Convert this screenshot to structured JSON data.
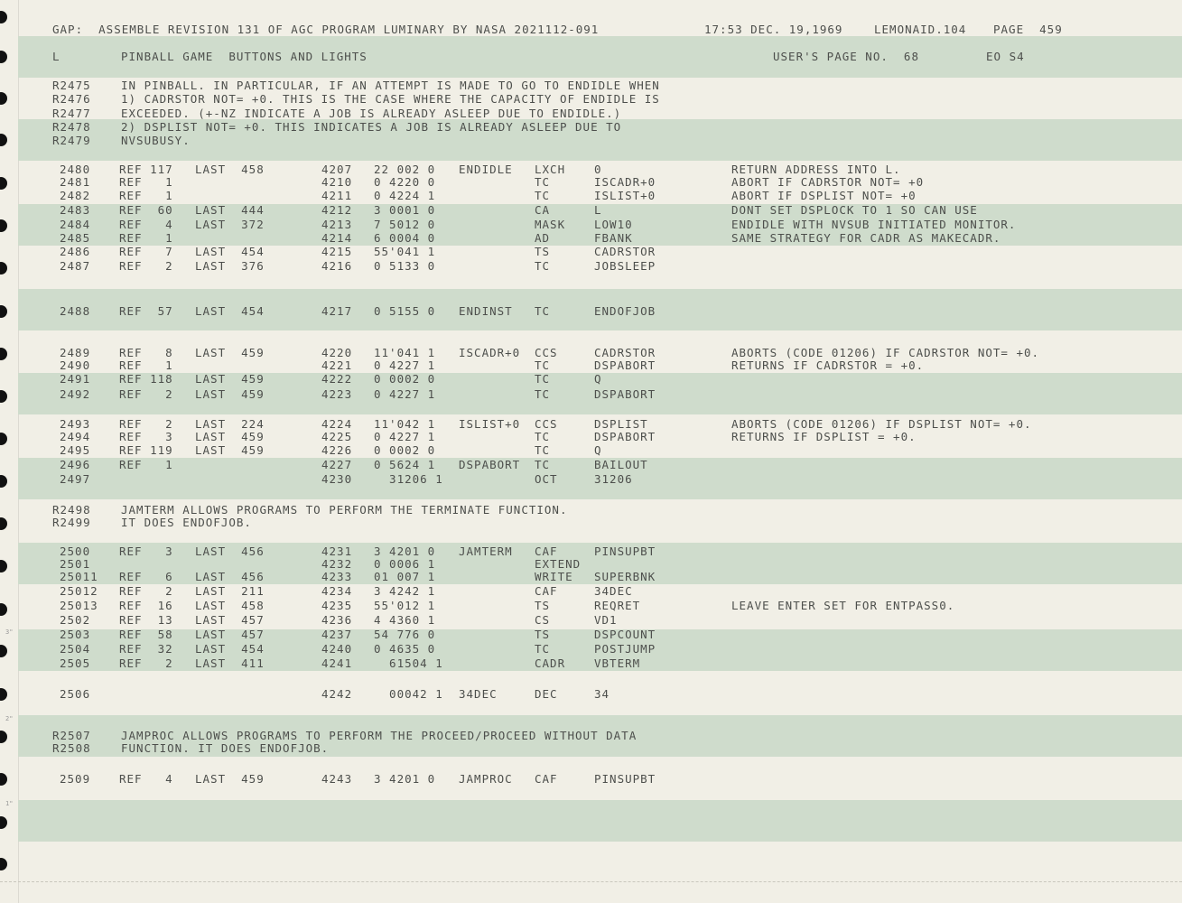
{
  "header": {
    "program_line": "GAP:  ASSEMBLE REVISION 131 OF AGC PROGRAM LUMINARY BY NASA 2021112-091",
    "timestamp": "17:53 DEC. 19,1969",
    "assembler": "LEMONAID.104",
    "page_label": "PAGE  459",
    "log_code": "L",
    "section_title": "PINBALL GAME  BUTTONS AND LIGHTS",
    "users_page": "USER'S PAGE NO.  68",
    "eo_code": "EO S4"
  },
  "comment1": [
    [
      "R2475",
      "IN PINBALL. IN PARTICULAR, IF AN ATTEMPT IS MADE TO GO TO ENDIDLE WHEN"
    ],
    [
      "R2476",
      "1) CADRSTOR NOT= +0. THIS IS THE CASE WHERE THE CAPACITY OF ENDIDLE IS"
    ],
    [
      "R2477",
      "EXCEEDED. (+-NZ INDICATE A JOB IS ALREADY ASLEEP DUE TO ENDIDLE.)"
    ],
    [
      "R2478",
      "2) DSPLIST NOT= +0. THIS INDICATES A JOB IS ALREADY ASLEEP DUE TO"
    ],
    [
      "R2479",
      "NVSUBUSY."
    ]
  ],
  "block1": [
    [
      "2480",
      "REF 117",
      "LAST  458",
      "4207",
      "22 002 0",
      "ENDIDLE",
      "LXCH",
      "0",
      "RETURN ADDRESS INTO L."
    ],
    [
      "2481",
      "REF   1",
      "",
      "4210",
      "0 4220 0",
      "",
      "TC",
      "ISCADR+0",
      "ABORT IF CADRSTOR NOT= +0"
    ],
    [
      "2482",
      "REF   1",
      "",
      "4211",
      "0 4224 1",
      "",
      "TC",
      "ISLIST+0",
      "ABORT IF DSPLIST NOT= +0"
    ],
    [
      "2483",
      "REF  60",
      "LAST  444",
      "4212",
      "3 0001 0",
      "",
      "CA",
      "L",
      "DONT SET DSPLOCK TO 1 SO CAN USE"
    ],
    [
      "2484",
      "REF   4",
      "LAST  372",
      "4213",
      "7 5012 0",
      "",
      "MASK",
      "LOW10",
      "ENDIDLE WITH NVSUB INITIATED MONITOR."
    ],
    [
      "2485",
      "REF   1",
      "",
      "4214",
      "6 0004 0",
      "",
      "AD",
      "FBANK",
      "SAME STRATEGY FOR CADR AS MAKECADR."
    ],
    [
      "2486",
      "REF   7",
      "LAST  454",
      "4215",
      "55'041 1",
      "",
      "TS",
      "CADRSTOR",
      ""
    ],
    [
      "2487",
      "REF   2",
      "LAST  376",
      "4216",
      "0 5133 0",
      "",
      "TC",
      "JOBSLEEP",
      ""
    ]
  ],
  "line2488": [
    "2488",
    "REF  57",
    "LAST  454",
    "4217",
    "0 5155 0",
    "ENDINST",
    "TC",
    "ENDOFJOB",
    ""
  ],
  "block2": [
    [
      "2489",
      "REF   8",
      "LAST  459",
      "4220",
      "11'041 1",
      "ISCADR+0",
      "CCS",
      "CADRSTOR",
      "ABORTS (CODE 01206) IF CADRSTOR NOT= +0."
    ],
    [
      "2490",
      "REF   1",
      "",
      "4221",
      "0 4227 1",
      "",
      "TC",
      "DSPABORT",
      "RETURNS IF CADRSTOR = +0."
    ],
    [
      "2491",
      "REF 118",
      "LAST  459",
      "4222",
      "0 0002 0",
      "",
      "TC",
      "Q",
      ""
    ],
    [
      "2492",
      "REF   2",
      "LAST  459",
      "4223",
      "0 4227 1",
      "",
      "TC",
      "DSPABORT",
      ""
    ]
  ],
  "block3": [
    [
      "2493",
      "REF   2",
      "LAST  224",
      "4224",
      "11'042 1",
      "ISLIST+0",
      "CCS",
      "DSPLIST",
      "ABORTS (CODE 01206) IF DSPLIST NOT= +0."
    ],
    [
      "2494",
      "REF   3",
      "LAST  459",
      "4225",
      "0 4227 1",
      "",
      "TC",
      "DSPABORT",
      "RETURNS IF DSPLIST = +0."
    ],
    [
      "2495",
      "REF 119",
      "LAST  459",
      "4226",
      "0 0002 0",
      "",
      "TC",
      "Q",
      ""
    ],
    [
      "2496",
      "REF   1",
      "",
      "4227",
      "0 5624 1",
      "DSPABORT",
      "TC",
      "BAILOUT",
      ""
    ],
    [
      "2497",
      "",
      "",
      "4230",
      "  31206 1",
      "",
      "OCT",
      "31206",
      ""
    ]
  ],
  "comment2": [
    [
      "R2498",
      "JAMTERM ALLOWS PROGRAMS TO PERFORM THE TERMINATE FUNCTION."
    ],
    [
      "R2499",
      "IT DOES ENDOFJOB."
    ]
  ],
  "block4": [
    [
      "2500",
      "REF   3",
      "LAST  456",
      "4231",
      "3 4201 0",
      "JAMTERM",
      "CAF",
      "PINSUPBT",
      ""
    ],
    [
      "2501",
      "",
      "",
      "4232",
      "0 0006 1",
      "",
      "EXTEND",
      "",
      ""
    ],
    [
      "25011",
      "REF   6",
      "LAST  456",
      "4233",
      "01 007 1",
      "",
      "WRITE",
      "SUPERBNK",
      ""
    ],
    [
      "25012",
      "REF   2",
      "LAST  211",
      "4234",
      "3 4242 1",
      "",
      "CAF",
      "34DEC",
      ""
    ],
    [
      "25013",
      "REF  16",
      "LAST  458",
      "4235",
      "55'012 1",
      "",
      "TS",
      "REQRET",
      "LEAVE ENTER SET FOR ENTPASS0."
    ],
    [
      "2502",
      "REF  13",
      "LAST  457",
      "4236",
      "4 4360 1",
      "",
      "CS",
      "VD1",
      ""
    ],
    [
      "2503",
      "REF  58",
      "LAST  457",
      "4237",
      "54 776 0",
      "",
      "TS",
      "DSPCOUNT",
      ""
    ],
    [
      "2504",
      "REF  32",
      "LAST  454",
      "4240",
      "0 4635 0",
      "",
      "TC",
      "POSTJUMP",
      ""
    ],
    [
      "2505",
      "REF   2",
      "LAST  411",
      "4241",
      "  61504 1",
      "",
      "CADR",
      "VBTERM",
      ""
    ]
  ],
  "line2506": [
    "2506",
    "",
    "",
    "4242",
    "  00042 1",
    "34DEC",
    "DEC",
    "34",
    ""
  ],
  "comment3": [
    [
      "R2507",
      "JAMPROC ALLOWS PROGRAMS TO PERFORM THE PROCEED/PROCEED WITHOUT DATA"
    ],
    [
      "R2508",
      "FUNCTION. IT DOES ENDOFJOB."
    ]
  ],
  "line2509": [
    "2509",
    "REF   4",
    "LAST  459",
    "4243",
    "3 4201 0",
    "JAMPROC",
    "CAF",
    "PINSUPBT",
    ""
  ],
  "margin_marks": [
    "3\"",
    "2\"",
    "1\""
  ]
}
